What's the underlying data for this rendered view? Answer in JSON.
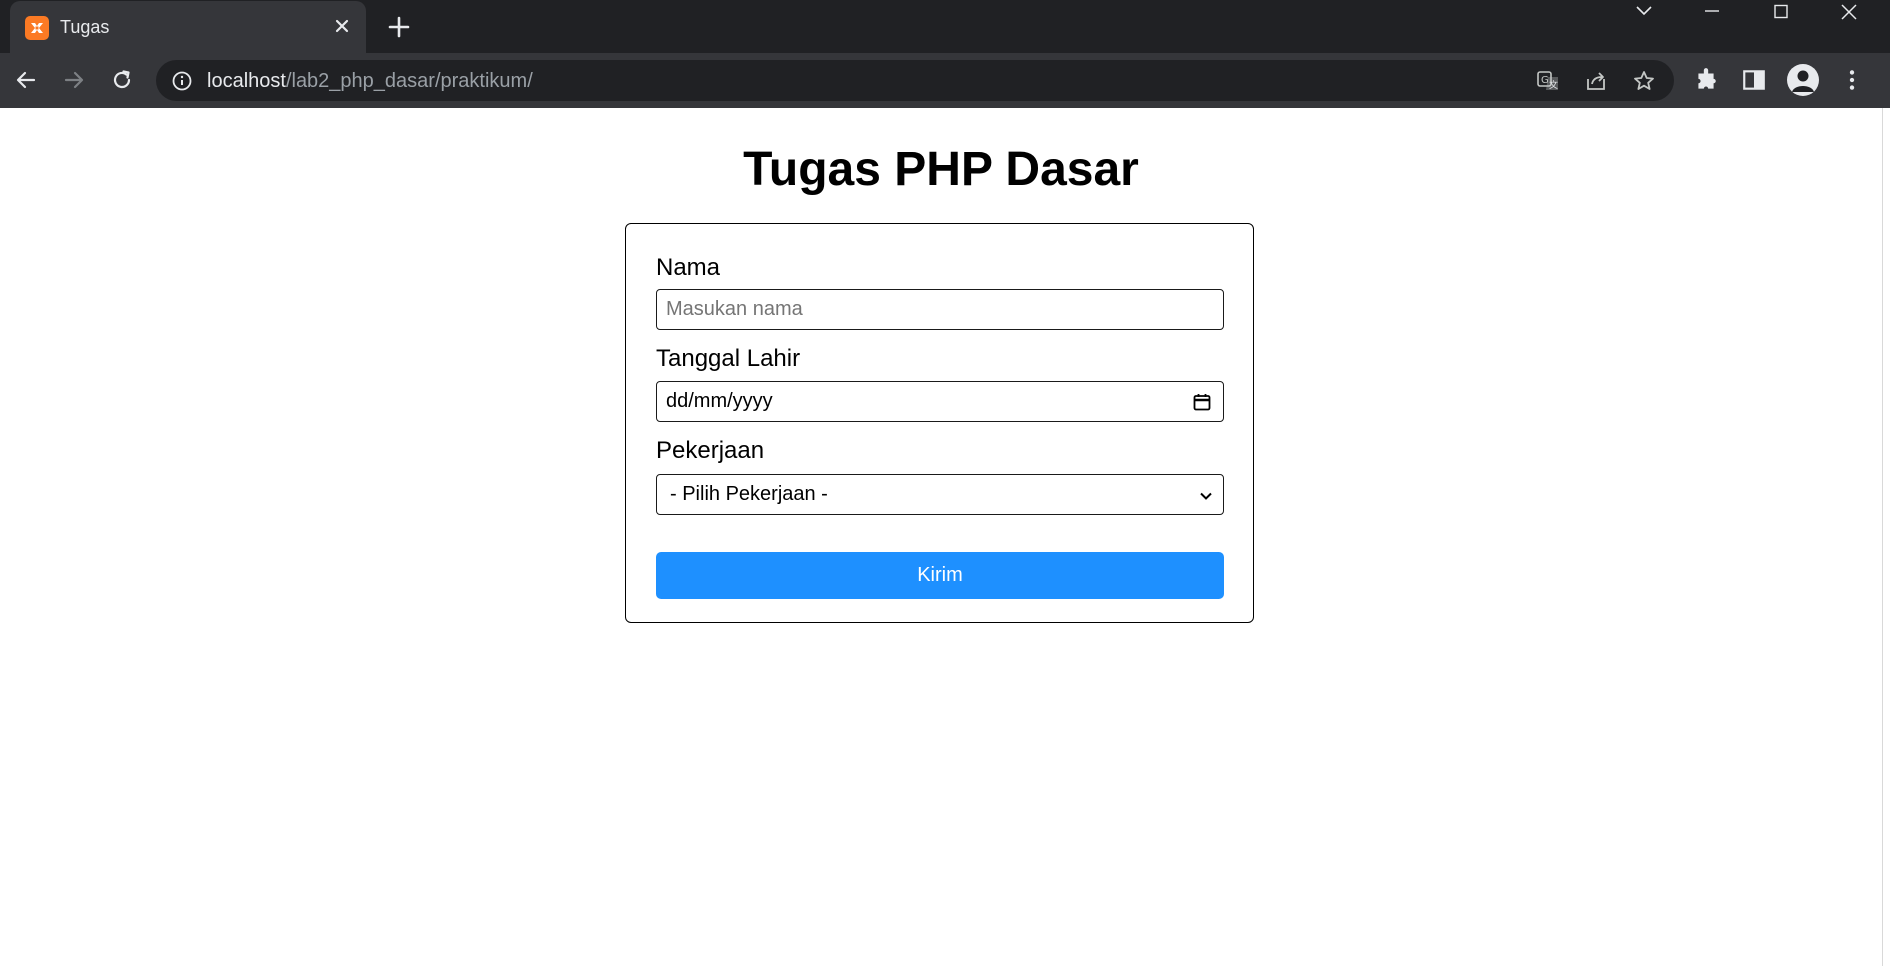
{
  "browser": {
    "tab_title": "Tugas",
    "url_host": "localhost",
    "url_path": "/lab2_php_dasar/praktikum/"
  },
  "page": {
    "title": "Tugas PHP Dasar",
    "form": {
      "nama_label": "Nama",
      "nama_placeholder": "Masukan nama",
      "tanggal_label": "Tanggal Lahir",
      "tanggal_value": "dd/mm/yyyy",
      "pekerjaan_label": "Pekerjaan",
      "pekerjaan_selected": "- Pilih Pekerjaan -",
      "submit_label": "Kirim"
    }
  },
  "colors": {
    "accent": "#1e90ff",
    "chrome_dark": "#202124",
    "chrome_toolbar": "#35363a",
    "favicon": "#fb7a24"
  },
  "icons": [
    "xampp-favicon-icon",
    "close-icon",
    "plus-icon",
    "chevron-down-icon",
    "minimize-icon",
    "maximize-icon",
    "back-icon",
    "forward-icon",
    "reload-icon",
    "info-icon",
    "translate-icon",
    "share-icon",
    "star-icon",
    "extensions-icon",
    "side-panel-icon",
    "profile-icon",
    "more-icon",
    "calendar-icon"
  ]
}
